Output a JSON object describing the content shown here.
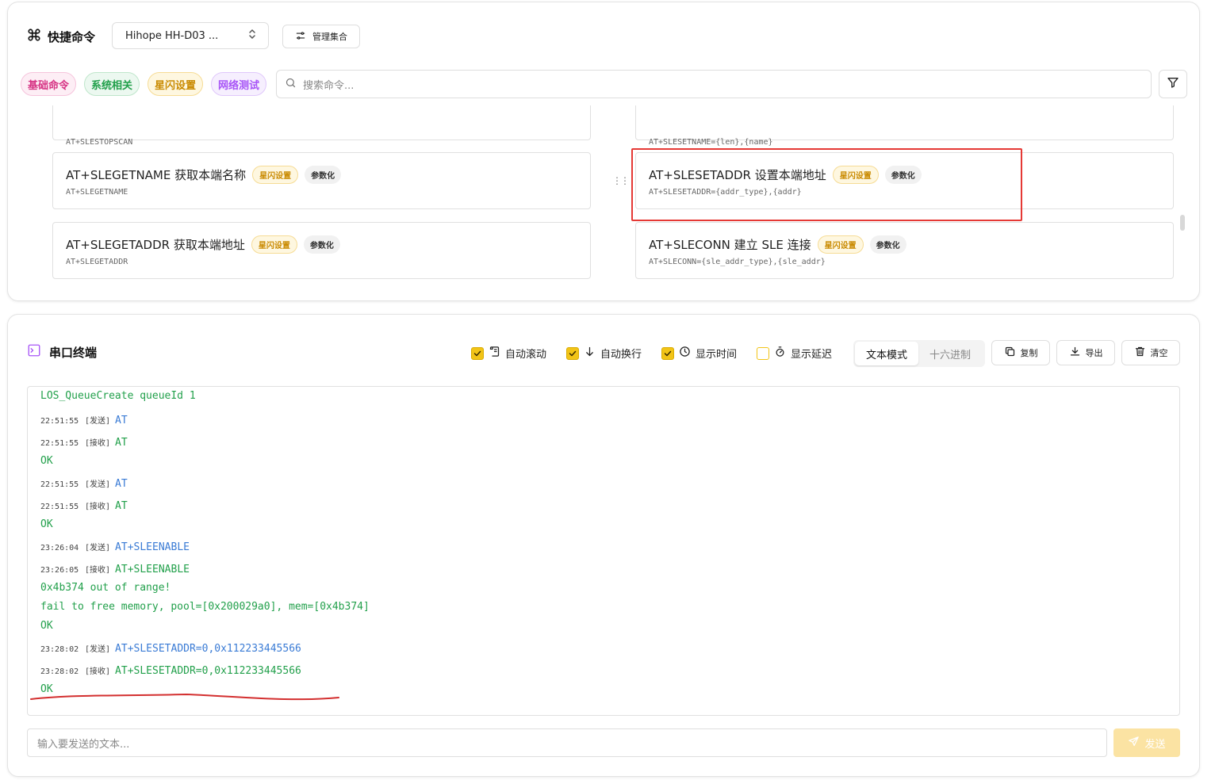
{
  "quick": {
    "title": "快捷命令",
    "device": "Hihope HH-D03 ...",
    "manage_label": "管理集合",
    "categories": [
      {
        "label": "基础命令",
        "color": "#d63384"
      },
      {
        "label": "系统相关",
        "color": "#22a04b"
      },
      {
        "label": "星闪设置",
        "color": "#c98a00"
      },
      {
        "label": "网络测试",
        "color": "#a855f7"
      }
    ],
    "search_placeholder": "搜索命令...",
    "commands": [
      {
        "title": "",
        "sub": "AT+SLESTOPSCAN"
      },
      {
        "title": "",
        "sub": "AT+SLESETNAME={len},{name}"
      },
      {
        "title": "AT+SLEGETNAME 获取本端名称",
        "badge1": "星闪设置",
        "badge2": "参数化",
        "sub": "AT+SLEGETNAME"
      },
      {
        "title": "AT+SLESETADDR 设置本端地址",
        "badge1": "星闪设置",
        "badge2": "参数化",
        "sub": "AT+SLESETADDR={addr_type},{addr}"
      },
      {
        "title": "AT+SLEGETADDR 获取本端地址",
        "badge1": "星闪设置",
        "badge2": "参数化",
        "sub": "AT+SLEGETADDR"
      },
      {
        "title": "AT+SLECONN 建立 SLE 连接",
        "badge1": "星闪设置",
        "badge2": "参数化",
        "sub": "AT+SLECONN={sle_addr_type},{sle_addr}"
      }
    ]
  },
  "terminal": {
    "title": "串口终端",
    "options": [
      {
        "label": "自动滚动",
        "checked": true
      },
      {
        "label": "自动换行",
        "checked": true
      },
      {
        "label": "显示时间",
        "checked": true
      },
      {
        "label": "显示延迟",
        "checked": false
      }
    ],
    "mode_text": "文本模式",
    "mode_hex": "十六进制",
    "copy_label": "复制",
    "export_label": "导出",
    "clear_label": "清空",
    "partial_line": "LOS_QueueCreate queueId 1",
    "log": [
      {
        "ts": "22:51:55",
        "tag": "[发送]",
        "kind": "send",
        "text": "AT"
      },
      {
        "ts": "22:51:55",
        "tag": "[接收]",
        "kind": "recv",
        "text": "AT"
      },
      {
        "ts": "",
        "tag": "",
        "kind": "recv",
        "text": "OK"
      },
      {
        "ts": "22:51:55",
        "tag": "[发送]",
        "kind": "send",
        "text": "AT"
      },
      {
        "ts": "22:51:55",
        "tag": "[接收]",
        "kind": "recv",
        "text": "AT"
      },
      {
        "ts": "",
        "tag": "",
        "kind": "recv",
        "text": "OK"
      },
      {
        "ts": "23:26:04",
        "tag": "[发送]",
        "kind": "send",
        "text": "AT+SLEENABLE"
      },
      {
        "ts": "23:26:05",
        "tag": "[接收]",
        "kind": "recv",
        "text": "AT+SLEENABLE"
      },
      {
        "ts": "",
        "tag": "",
        "kind": "recv",
        "text": "0x4b374 out of range!"
      },
      {
        "ts": "",
        "tag": "",
        "kind": "recv",
        "text": "fail to free memory, pool=[0x200029a0], mem=[0x4b374]"
      },
      {
        "ts": "",
        "tag": "",
        "kind": "recv",
        "text": "OK"
      },
      {
        "ts": "23:28:02",
        "tag": "[发送]",
        "kind": "send",
        "text": "AT+SLESETADDR=0,0x112233445566"
      },
      {
        "ts": "23:28:02",
        "tag": "[接收]",
        "kind": "recv",
        "text": "AT+SLESETADDR=0,0x112233445566"
      },
      {
        "ts": "",
        "tag": "",
        "kind": "recv",
        "text": "OK"
      }
    ],
    "input_placeholder": "输入要发送的文本...",
    "send_label": "发送"
  }
}
